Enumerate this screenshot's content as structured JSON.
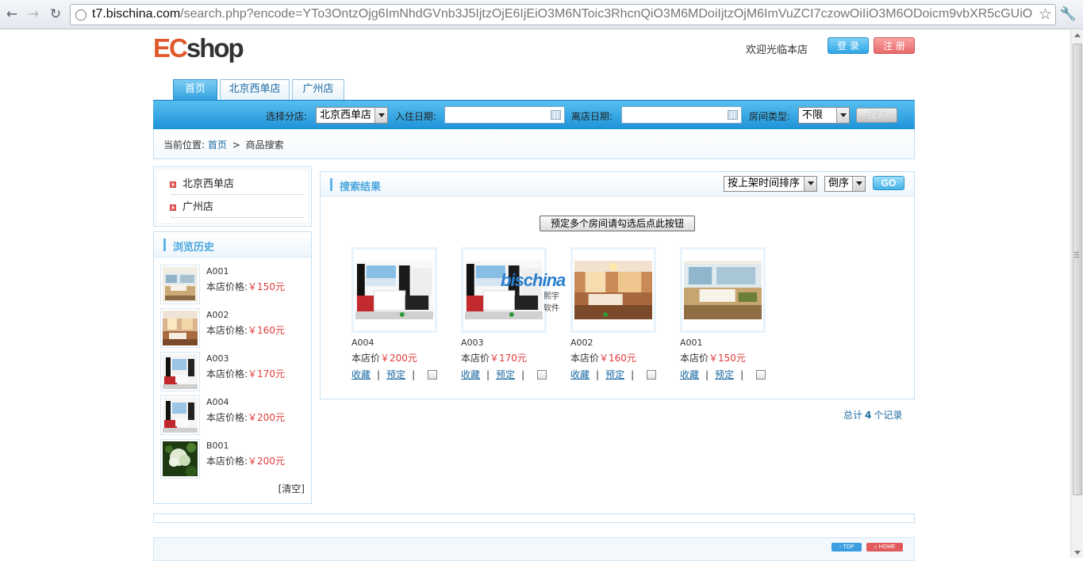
{
  "browser": {
    "url_host": "t7.bischina.com",
    "url_rest": "/search.php?encode=YTo3OntzOjg6ImNhdGVnb3J5IjtzOjE6IjEiO3M6NToic3RhcnQiO3M6MDoiIjtzOjM6ImVuZCI7czowOiIiO3M6ODoicm9vbXR5cGUiO"
  },
  "header": {
    "logo_ec": "EC",
    "logo_shop": "shop",
    "welcome": "欢迎光临本店",
    "login": "登 录",
    "register": "注 册"
  },
  "nav_tabs": [
    "首页",
    "北京西单店",
    "广州店"
  ],
  "searchbar": {
    "branch_label": "选择分店:",
    "branch_value": "北京西单店",
    "checkin_label": "入住日期:",
    "checkout_label": "离店日期:",
    "roomtype_label": "房间类型:",
    "roomtype_value": "不限",
    "search_button": "搜索"
  },
  "breadcrumb": {
    "prefix": "当前位置:",
    "home": "首页",
    "separator": ">",
    "current": "商品搜索"
  },
  "sidebar": {
    "shops": [
      "北京西单店",
      "广州店"
    ],
    "history_title": "浏览历史",
    "history": [
      {
        "name": "A001",
        "price_label": "本店价格:",
        "price": "￥150元"
      },
      {
        "name": "A002",
        "price_label": "本店价格:",
        "price": "￥160元"
      },
      {
        "name": "A003",
        "price_label": "本店价格:",
        "price": "￥170元"
      },
      {
        "name": "A004",
        "price_label": "本店价格:",
        "price": "￥200元"
      },
      {
        "name": "B001",
        "price_label": "本店价格:",
        "price": "￥200元"
      }
    ],
    "clear": "[清空]"
  },
  "results": {
    "title": "搜索结果",
    "sort_by": "按上架时间排序",
    "order": "倒序",
    "go": "GO",
    "multi_book_button": "预定多个房间请勾选后点此按钮",
    "products": [
      {
        "name": "A004",
        "price_label": "本店价",
        "price": "￥200元",
        "fav": "收藏",
        "book": "预定"
      },
      {
        "name": "A003",
        "price_label": "本店价",
        "price": "￥170元",
        "fav": "收藏",
        "book": "预定"
      },
      {
        "name": "A002",
        "price_label": "本店价",
        "price": "￥160元",
        "fav": "收藏",
        "book": "预定"
      },
      {
        "name": "A001",
        "price_label": "本店价",
        "price": "￥150元",
        "fav": "收藏",
        "book": "预定"
      }
    ],
    "watermark": "bischina",
    "watermark_sub": "熙宇软件",
    "total_prefix": "总计",
    "total_count": "4",
    "total_suffix": "个记录"
  },
  "footer": {
    "top": "↑ TOP",
    "home": "⌂ HOME"
  },
  "colors": {
    "accent_blue": "#1d6aa3",
    "price_red": "#e03a3a",
    "bar_blue": "#1f93d8"
  }
}
